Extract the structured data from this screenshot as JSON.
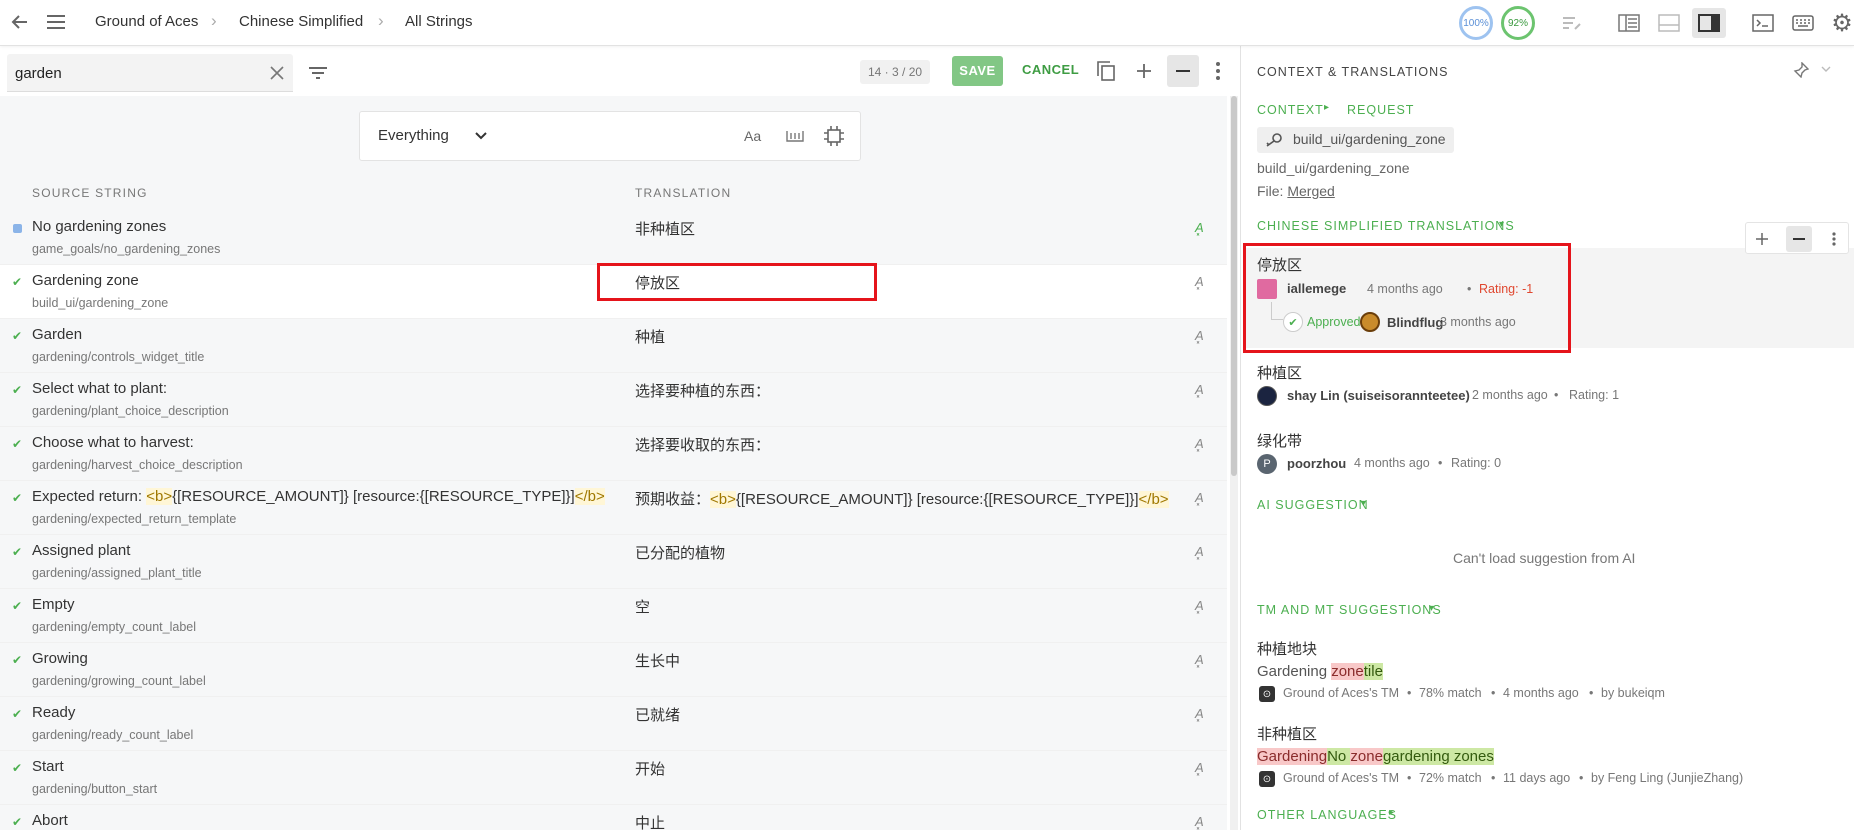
{
  "breadcrumbs": [
    "Ground of Aces",
    "Chinese Simplified",
    "All Strings"
  ],
  "header": {
    "progress_translated": "100%",
    "progress_approved": "92%"
  },
  "search": {
    "value": "garden"
  },
  "editor": {
    "counter": "14 · 3 / 20",
    "save": "SAVE",
    "cancel": "CANCEL"
  },
  "filter": {
    "scope": "Everything",
    "case_label": "Aa"
  },
  "columns": {
    "source": "SOURCE STRING",
    "translation": "TRANSLATION"
  },
  "rows": [
    {
      "src": "No gardening zones",
      "key": "game_goals/no_gardening_zones",
      "tr": "非种植区",
      "status": "untranslated"
    },
    {
      "src": "Gardening zone",
      "key": "build_ui/gardening_zone",
      "tr": "停放区",
      "status": "approved"
    },
    {
      "src": "Garden",
      "key": "gardening/controls_widget_title",
      "tr": "种植",
      "status": "approved"
    },
    {
      "src": "Select what to plant:",
      "key": "gardening/plant_choice_description",
      "tr": "选择要种植的东西：",
      "status": "approved"
    },
    {
      "src": "Choose what to harvest:",
      "key": "gardening/harvest_choice_description",
      "tr": "选择要收取的东西：",
      "status": "approved"
    },
    {
      "src_parts": [
        "Expected return: ",
        "<b>",
        "{[RESOURCE_AMOUNT]} [resource:{[RESOURCE_TYPE]}]",
        "</b>"
      ],
      "key": "gardening/expected_return_template",
      "tr_parts": [
        "预期收益：",
        "<b>",
        "{[RESOURCE_AMOUNT]} [resource:{[RESOURCE_TYPE]}]",
        "</b>"
      ],
      "status": "approved"
    },
    {
      "src": "Assigned plant",
      "key": "gardening/assigned_plant_title",
      "tr": "已分配的植物",
      "status": "approved"
    },
    {
      "src": "Empty",
      "key": "gardening/empty_count_label",
      "tr": "空",
      "status": "approved"
    },
    {
      "src": "Growing",
      "key": "gardening/growing_count_label",
      "tr": "生长中",
      "status": "approved"
    },
    {
      "src": "Ready",
      "key": "gardening/ready_count_label",
      "tr": "已就绪",
      "status": "approved"
    },
    {
      "src": "Start",
      "key": "gardening/button_start",
      "tr": "开始",
      "status": "approved"
    },
    {
      "src": "Abort",
      "key": "",
      "tr": "中止",
      "status": "approved"
    }
  ],
  "right_panel": {
    "title": "CONTEXT & TRANSLATIONS",
    "tab_context": "CONTEXT",
    "tab_request": "REQUEST",
    "key": "build_ui/gardening_zone",
    "key_plain": "build_ui/gardening_zone",
    "file_label": "File: ",
    "file_value": "Merged",
    "translations_title": "CHINESE SIMPLIFIED TRANSLATIONS",
    "translations": [
      {
        "text": "停放区",
        "user": "iallemege",
        "time": "4 months ago",
        "rating": "Rating: -1",
        "approved_label": "Approved",
        "approver": "Blindflug",
        "approved_time": "3 months ago"
      },
      {
        "text": "种植区",
        "user": "shay Lin (suiseisorannteetee)",
        "time": "2 months ago",
        "rating": "Rating: 1"
      },
      {
        "text": "绿化带",
        "user": "poorzhou",
        "time": "4 months ago",
        "rating": "Rating: 0",
        "initial": "P"
      }
    ],
    "ai_title": "AI SUGGESTION",
    "ai_message": "Can't load suggestion from AI",
    "tm_title": "TM AND MT SUGGESTIONS",
    "tm": [
      {
        "text": "种植地块",
        "source_same": "Gardening ",
        "source_del": "zone",
        "source_ins": "tile",
        "tm_name": "Ground of Aces's TM",
        "match": "78% match",
        "time": "4 months ago",
        "author": "by bukeiqm"
      },
      {
        "text": "非种植区",
        "src_del1": "Gardening",
        "src_ins1": "No ",
        "src_del2": "zone",
        "src_ins2": "gardening zones",
        "tm_name": "Ground of Aces's TM",
        "match": "72% match",
        "time": "11 days ago",
        "author": "by Feng Ling (JunjieZhang)"
      }
    ],
    "other_languages": "OTHER LANGUAGES"
  },
  "colors": {
    "accent": "#4caf50",
    "highlight": "#e5141b"
  }
}
